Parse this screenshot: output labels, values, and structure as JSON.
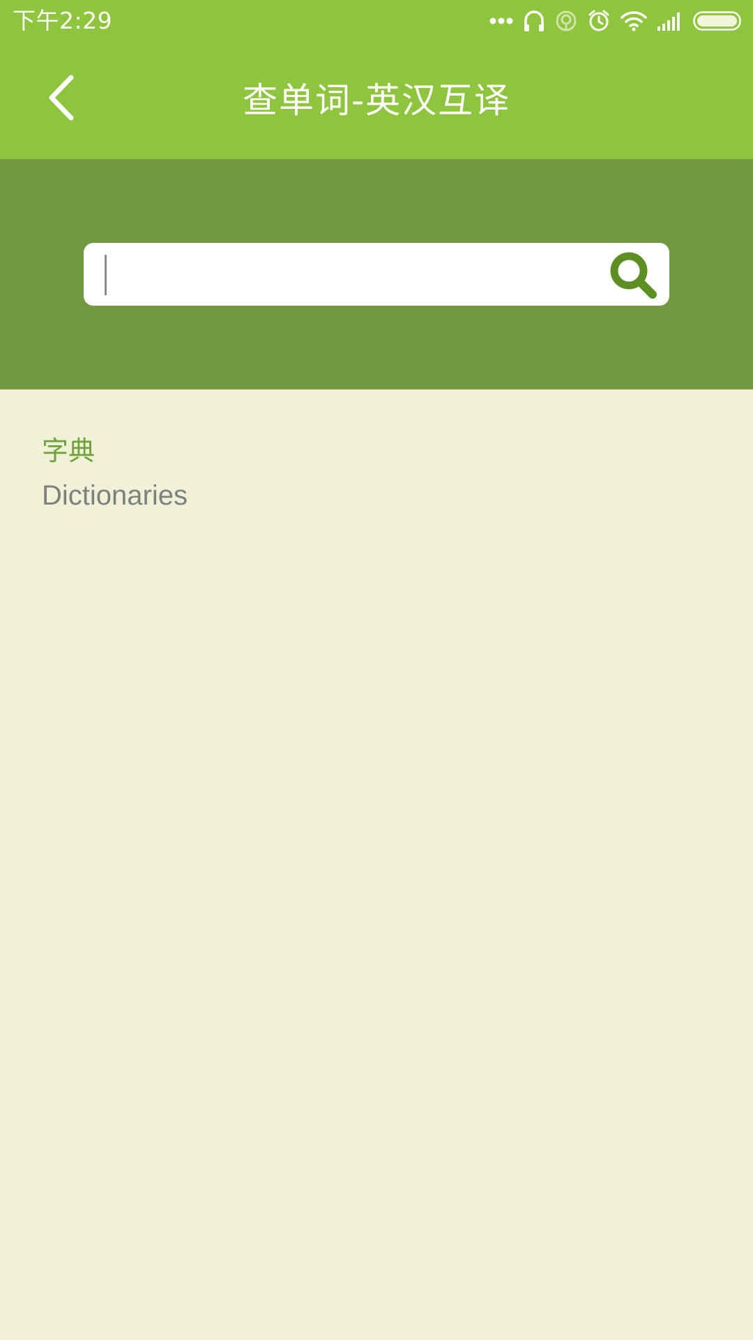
{
  "status_bar": {
    "time": "下午2:29",
    "icons": [
      "more-dots-icon",
      "headset-icon",
      "hotspot-icon",
      "alarm-icon",
      "wifi-icon",
      "signal-icon",
      "battery-icon"
    ]
  },
  "toolbar": {
    "title": "查单词-英汉互译",
    "back_icon": "chevron-left-icon"
  },
  "search": {
    "value": "",
    "placeholder": "",
    "icon": "search-icon"
  },
  "dictionaries": [
    {
      "title": "字典",
      "subtitle": "Dictionaries"
    }
  ],
  "colors": {
    "primary": "#8fc43e",
    "search_bg": "#729941",
    "page_bg": "#f0f1d6",
    "accent_text": "#6fa23a",
    "secondary_text": "#808080",
    "search_icon": "#5e8f25"
  }
}
